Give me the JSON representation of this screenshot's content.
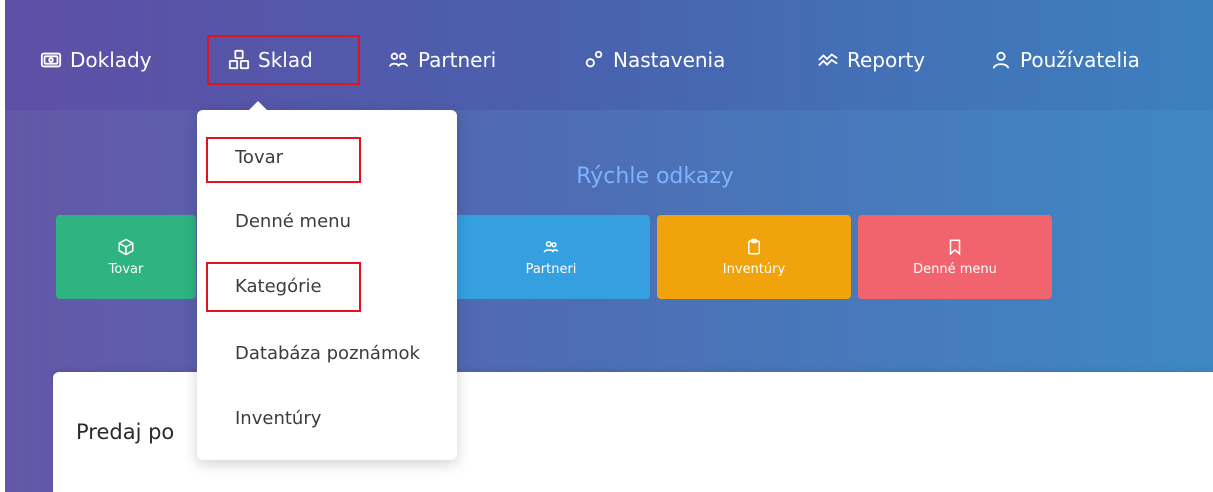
{
  "nav": {
    "items": [
      {
        "label": "Doklady",
        "icon": "receipt-icon"
      },
      {
        "label": "Sklad",
        "icon": "boxes-icon"
      },
      {
        "label": "Partneri",
        "icon": "users-icon"
      },
      {
        "label": "Nastavenia",
        "icon": "gears-icon"
      },
      {
        "label": "Reporty",
        "icon": "chart-icon"
      },
      {
        "label": "Používatelia",
        "icon": "user-icon"
      }
    ]
  },
  "dropdown": {
    "items": [
      {
        "label": "Tovar"
      },
      {
        "label": "Denné menu"
      },
      {
        "label": "Kategórie"
      },
      {
        "label": "Databáza poznámok"
      },
      {
        "label": "Inventúry"
      }
    ]
  },
  "quick_links": {
    "title": "Rýchle odkazy",
    "cards": [
      {
        "label": "Tovar",
        "icon": "cube-icon",
        "color": "#2fb481"
      },
      {
        "label": "Partneri",
        "icon": "users-icon",
        "color": "#35a0e0"
      },
      {
        "label": "Inventúry",
        "icon": "clipboard-icon",
        "color": "#f0a30a"
      },
      {
        "label": "Denné menu",
        "icon": "bookmark-icon",
        "color": "#f2646d"
      }
    ]
  },
  "panel": {
    "title": "Predaj po"
  },
  "colors": {
    "highlight": "#e0141e",
    "quick_title": "#7eb2ff"
  }
}
